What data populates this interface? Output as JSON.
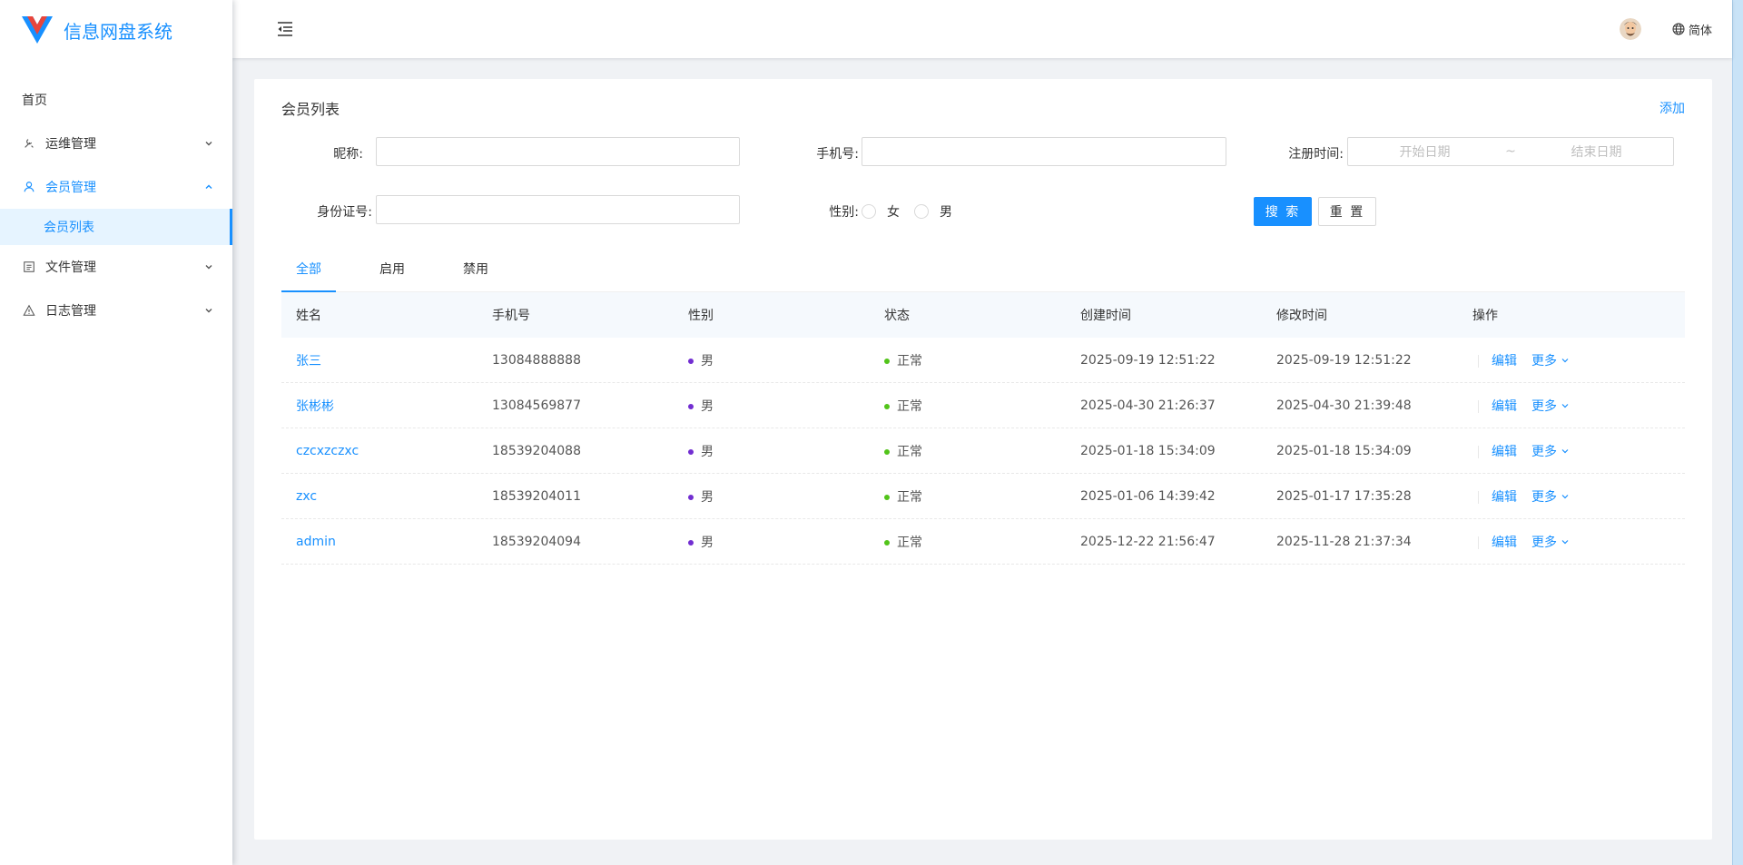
{
  "app": {
    "title": "信息网盘系统"
  },
  "sidebar": {
    "items": [
      {
        "label": "首页"
      },
      {
        "label": "运维管理"
      },
      {
        "label": "会员管理"
      },
      {
        "label": "会员列表"
      },
      {
        "label": "文件管理"
      },
      {
        "label": "日志管理"
      }
    ]
  },
  "header": {
    "lang": "简体"
  },
  "page": {
    "title": "会员列表",
    "add_label": "添加"
  },
  "filters": {
    "nickname_label": "昵称:",
    "phone_label": "手机号:",
    "reg_time_label": "注册时间:",
    "start_placeholder": "开始日期",
    "range_sep": "~",
    "end_placeholder": "结束日期",
    "idcard_label": "身份证号:",
    "gender_label": "性别:",
    "gender_female": "女",
    "gender_male": "男",
    "search_label": "搜 索",
    "reset_label": "重 置"
  },
  "tabs": [
    {
      "label": "全部"
    },
    {
      "label": "启用"
    },
    {
      "label": "禁用"
    }
  ],
  "table": {
    "columns": [
      "姓名",
      "手机号",
      "性别",
      "状态",
      "创建时间",
      "修改时间",
      "操作"
    ],
    "edit_label": "编辑",
    "more_label": "更多",
    "rows": [
      {
        "name": "张三",
        "phone": "13084888888",
        "gender": "男",
        "status": "正常",
        "created": "2025-09-19 12:51:22",
        "modified": "2025-09-19 12:51:22"
      },
      {
        "name": "张彬彬",
        "phone": "13084569877",
        "gender": "男",
        "status": "正常",
        "created": "2025-04-30 21:26:37",
        "modified": "2025-04-30 21:39:48"
      },
      {
        "name": "czcxzczxc",
        "phone": "18539204088",
        "gender": "男",
        "status": "正常",
        "created": "2025-01-18 15:34:09",
        "modified": "2025-01-18 15:34:09"
      },
      {
        "name": "zxc",
        "phone": "18539204011",
        "gender": "男",
        "status": "正常",
        "created": "2025-01-06 14:39:42",
        "modified": "2025-01-17 17:35:28"
      },
      {
        "name": "admin",
        "phone": "18539204094",
        "gender": "男",
        "status": "正常",
        "created": "2025-12-22 21:56:47",
        "modified": "2025-11-28 21:37:34"
      }
    ]
  },
  "colors": {
    "primary": "#1890ff",
    "gender_dot": "#722ed1",
    "status_dot": "#52c41a"
  }
}
